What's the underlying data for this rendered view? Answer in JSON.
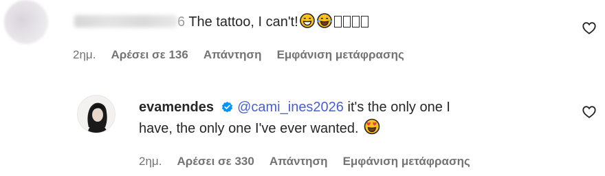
{
  "comments": [
    {
      "username_suffix": "6",
      "text": " The tattoo, I can't!",
      "time": "2ημ.",
      "likes": "Αρέσει σε 136",
      "reply": "Απάντηση",
      "translate": "Εμφάνιση μετάφρασης"
    },
    {
      "username": "evamendes",
      "mention": "@cami_ines2026",
      "text_line1": " it's the only one I",
      "text_line2": "have, the only one I've ever wanted.",
      "time": "2ημ.",
      "likes": "Αρέσει σε 330",
      "reply": "Απάντηση",
      "translate": "Εμφάνιση μετάφρασης"
    }
  ],
  "icons": {
    "like": "heart-outline-icon",
    "verified": "verified-badge-icon",
    "emoji_grin": "grinning-face-emoji",
    "emoji_tears": "tears-of-joy-emoji",
    "emoji_hearts": "heart-eyes-emoji"
  },
  "colors": {
    "text": "#262626",
    "secondary": "#737373",
    "mention": "#4a5dd8",
    "verified": "#0095f6"
  }
}
